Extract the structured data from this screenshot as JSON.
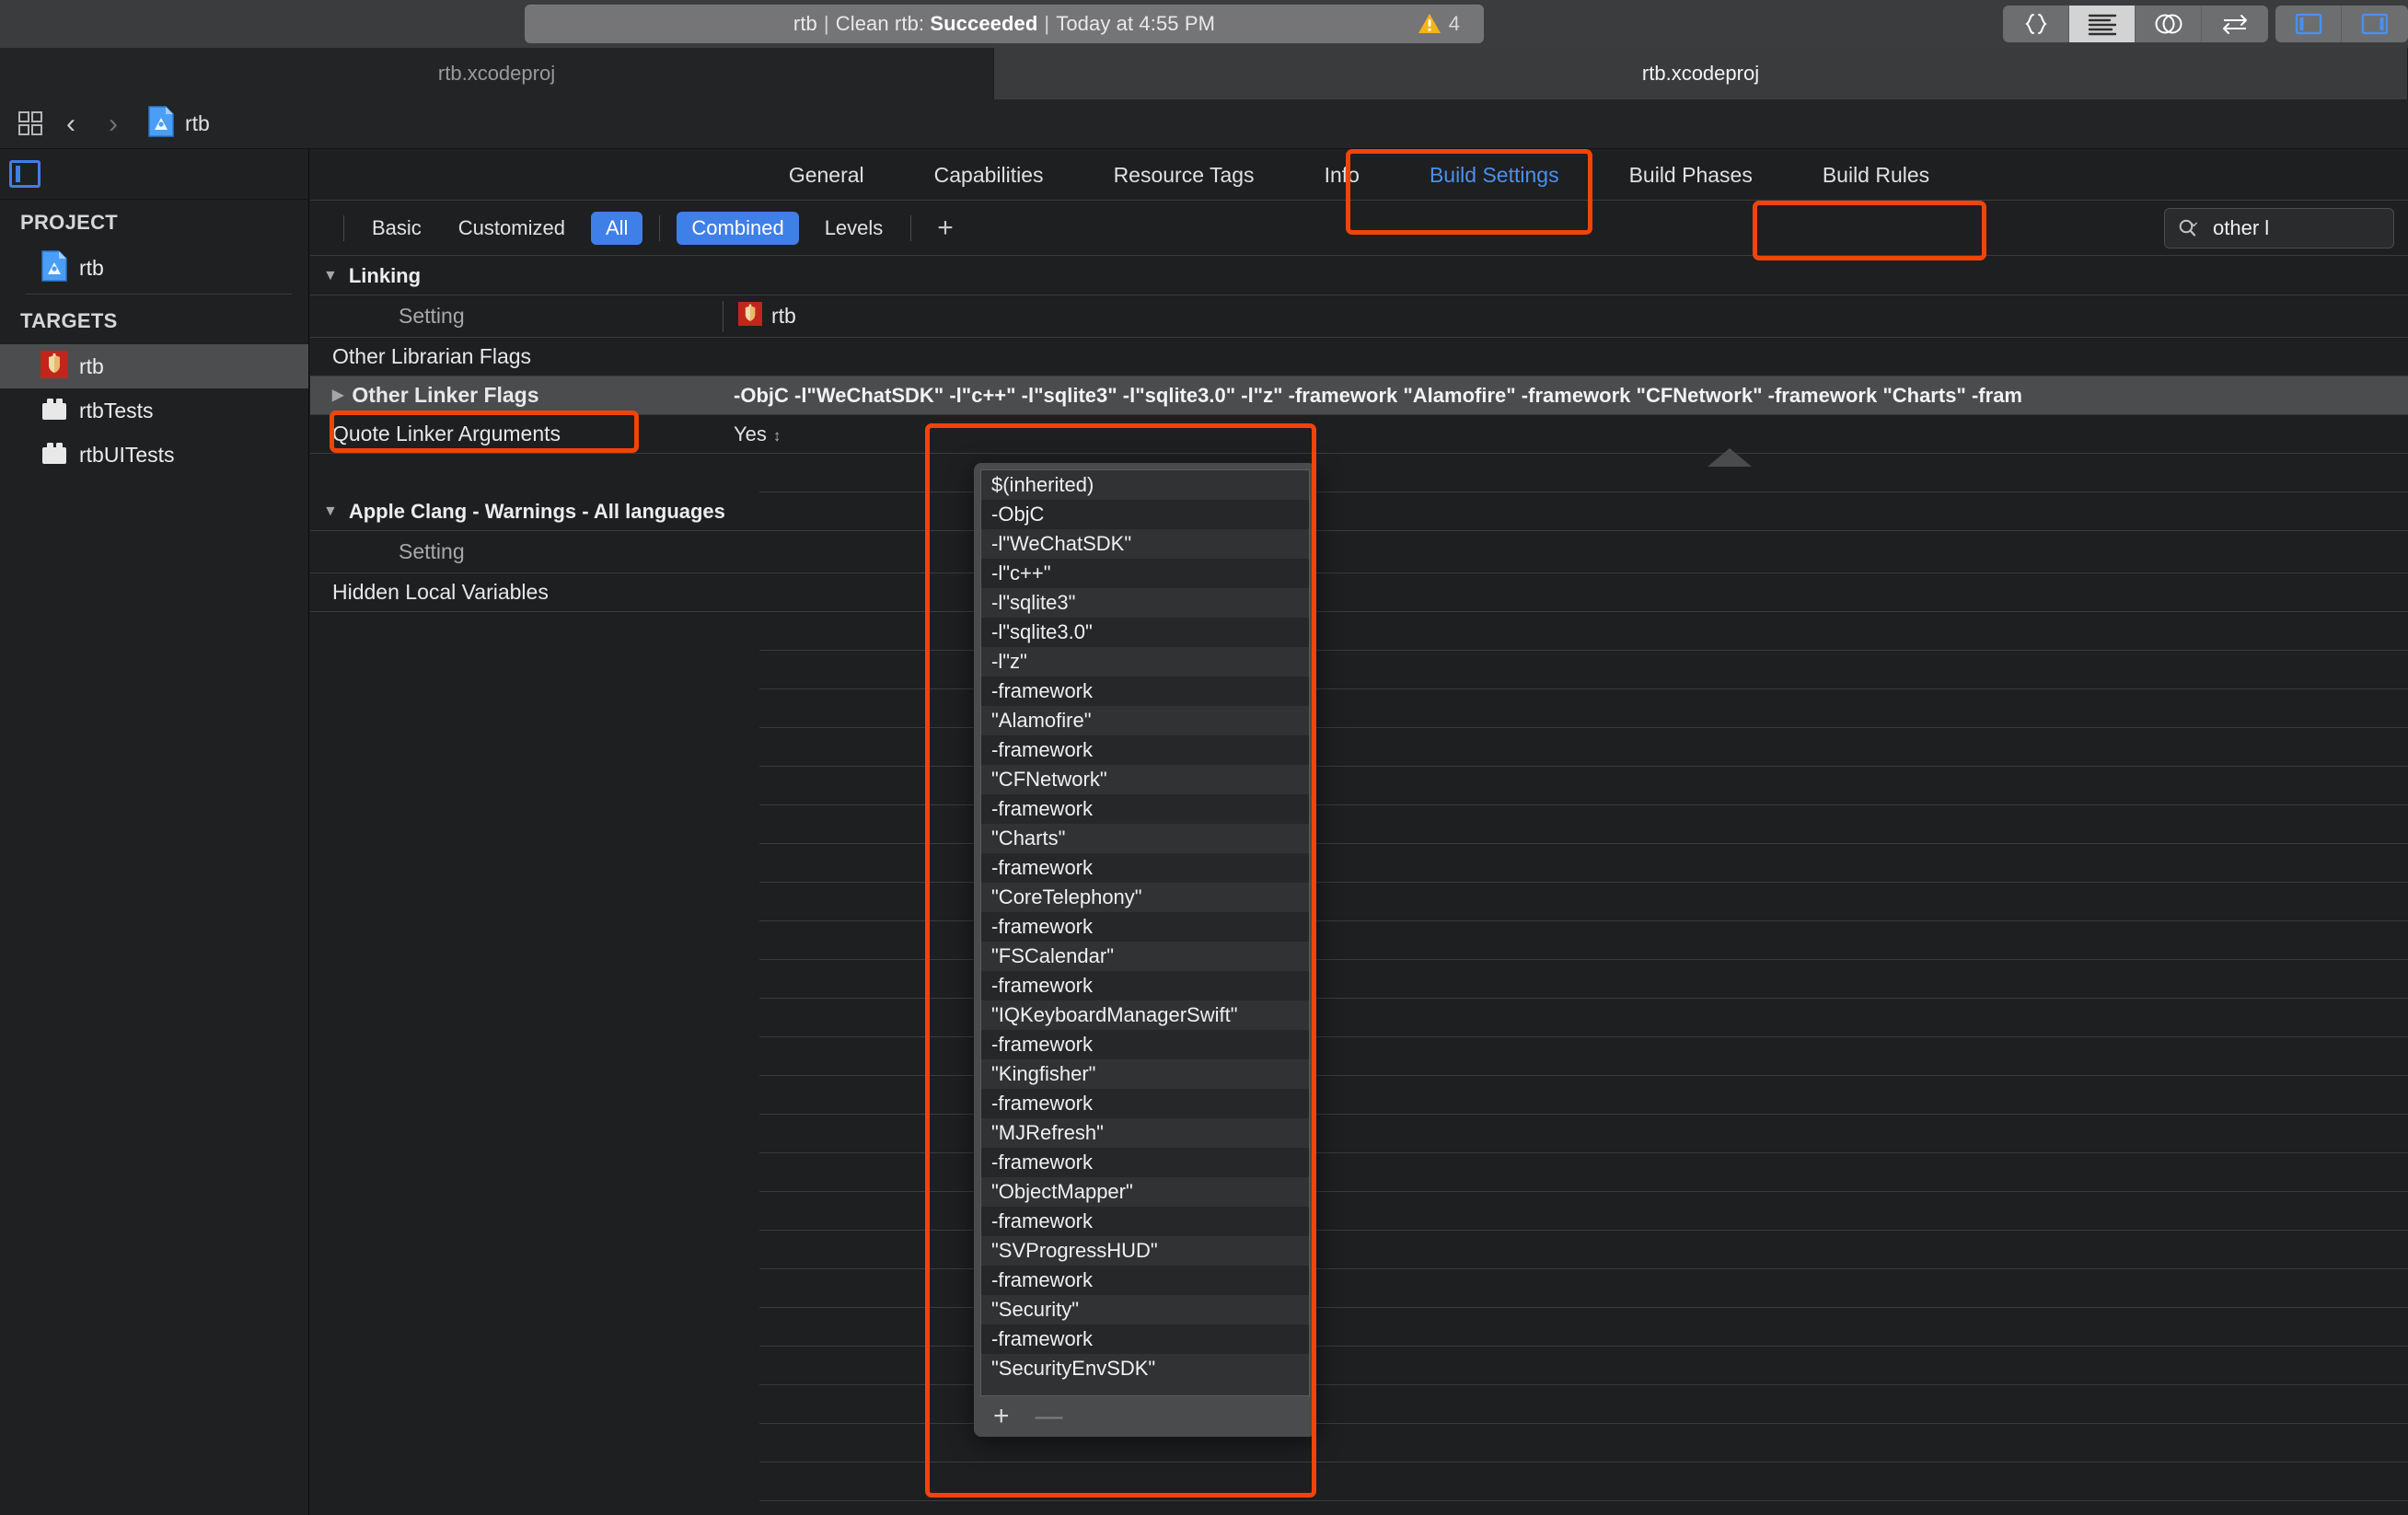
{
  "toolbar": {
    "status": {
      "scheme": "rtb",
      "action": "Clean rtb:",
      "result": "Succeeded",
      "time": "Today at 4:55 PM"
    },
    "warning_count": "4",
    "buttons": [
      {
        "name": "code-braces-button",
        "glyph": "{ }"
      },
      {
        "name": "standard-editor-button",
        "glyph": "lines"
      },
      {
        "name": "assistant-editor-button",
        "glyph": "venn"
      },
      {
        "name": "version-editor-button",
        "glyph": "arrows"
      },
      {
        "name": "navigator-toggle-button",
        "glyph": "panel-left"
      },
      {
        "name": "inspector-toggle-button",
        "glyph": "panel-right"
      }
    ]
  },
  "tabs": [
    {
      "label": "rtb.xcodeproj",
      "active": false
    },
    {
      "label": "rtb.xcodeproj",
      "active": true
    }
  ],
  "jumpbar": {
    "breadcrumb": "rtb"
  },
  "sidebar": {
    "project_header": "PROJECT",
    "project_items": [
      {
        "label": "rtb"
      }
    ],
    "targets_header": "TARGETS",
    "target_items": [
      {
        "label": "rtb",
        "selected": true
      },
      {
        "label": "rtbTests",
        "selected": false
      },
      {
        "label": "rtbUITests",
        "selected": false
      }
    ]
  },
  "editor": {
    "tabs": [
      {
        "label": "General",
        "active": false
      },
      {
        "label": "Capabilities",
        "active": false
      },
      {
        "label": "Resource Tags",
        "active": false
      },
      {
        "label": "Info",
        "active": false
      },
      {
        "label": "Build Settings",
        "active": true
      },
      {
        "label": "Build Phases",
        "active": false
      },
      {
        "label": "Build Rules",
        "active": false
      }
    ],
    "filters": {
      "basic": "Basic",
      "customized": "Customized",
      "all": "All",
      "combined": "Combined",
      "levels": "Levels",
      "add": "+"
    },
    "search": {
      "value": "other l",
      "placeholder": "Search"
    },
    "column_headers": {
      "setting": "Setting",
      "target": "rtb"
    },
    "groups": [
      {
        "title": "Linking",
        "rows": [
          {
            "label": "Other Librarian Flags",
            "value": "",
            "selected": false,
            "expandable": false
          },
          {
            "label": "Other Linker Flags",
            "value": "-ObjC -l\"WeChatSDK\" -l\"c++\" -l\"sqlite3\" -l\"sqlite3.0\" -l\"z\" -framework \"Alamofire\" -framework \"CFNetwork\" -framework \"Charts\" -fram",
            "selected": true,
            "expandable": true
          },
          {
            "label": "Quote Linker Arguments",
            "value": "Yes",
            "selected": false,
            "expandable": false,
            "is_popup": true
          }
        ]
      },
      {
        "title": "Apple Clang - Warnings - All languages",
        "rows": [
          {
            "label": "Hidden Local Variables",
            "value": "",
            "selected": false,
            "expandable": false
          }
        ]
      }
    ]
  },
  "popover": {
    "items": [
      "$(inherited)",
      "-ObjC",
      "-l\"WeChatSDK\"",
      "-l\"c++\"",
      "-l\"sqlite3\"",
      "-l\"sqlite3.0\"",
      "-l\"z\"",
      "-framework",
      "\"Alamofire\"",
      "-framework",
      "\"CFNetwork\"",
      "-framework",
      "\"Charts\"",
      "-framework",
      "\"CoreTelephony\"",
      "-framework",
      "\"FSCalendar\"",
      "-framework",
      "\"IQKeyboardManagerSwift\"",
      "-framework",
      "\"Kingfisher\"",
      "-framework",
      "\"MJRefresh\"",
      "-framework",
      "\"ObjectMapper\"",
      "-framework",
      "\"SVProgressHUD\"",
      "-framework",
      "\"Security\"",
      "-framework",
      "\"SecurityEnvSDK\""
    ],
    "add_label": "+",
    "remove_label": "—"
  },
  "colors": {
    "accent_blue": "#3f7fe8",
    "annotation_orange": "#f1440b",
    "warning_yellow": "#f5b417",
    "target_red": "#c0261b"
  }
}
